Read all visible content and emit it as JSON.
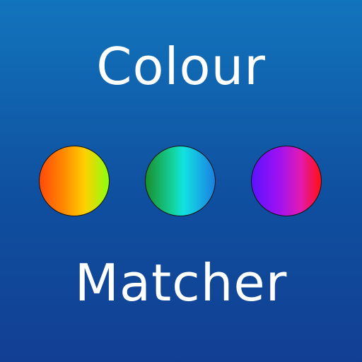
{
  "title": {
    "top": "Colour",
    "bottom": "Matcher"
  },
  "colors": {
    "background_top": "#1274bc",
    "background_bottom": "#123f93",
    "text": "#ffffff",
    "circle_1": [
      "#ff4a0a",
      "#ff8a00",
      "#ffd000",
      "#8cff10"
    ],
    "circle_2": [
      "#1a8f2d",
      "#13d4a0",
      "#12e2e2",
      "#1b7fe2"
    ],
    "circle_3": [
      "#5a13ff",
      "#a012f0",
      "#e11ab4",
      "#ff1010"
    ]
  },
  "icons": [
    "orange-green-gradient-circle-icon",
    "green-cyan-blue-gradient-circle-icon",
    "purple-pink-red-gradient-circle-icon"
  ]
}
